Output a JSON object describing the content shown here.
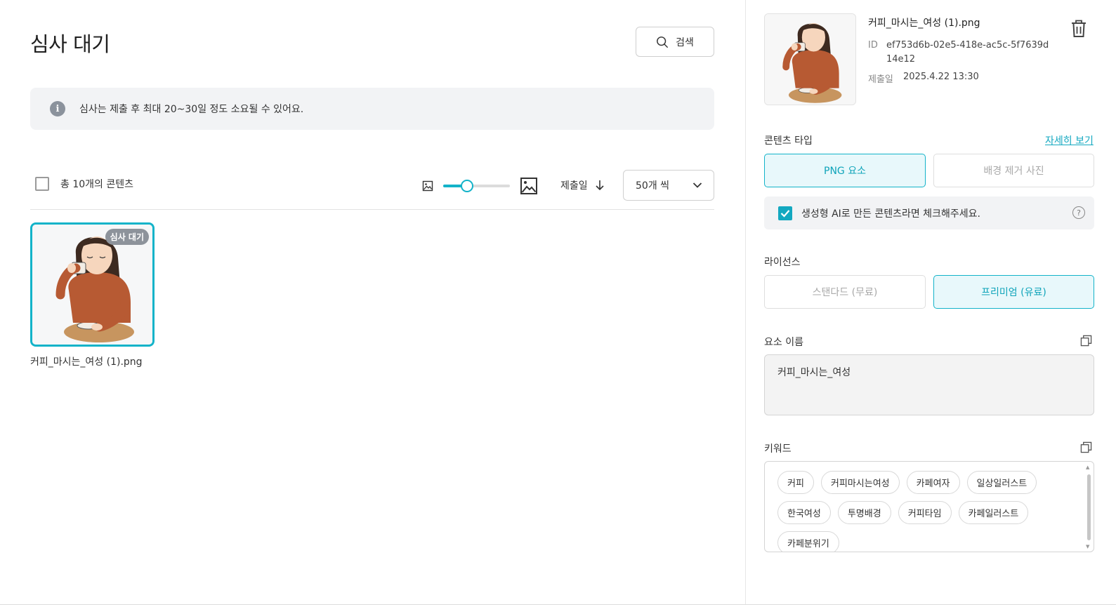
{
  "page": {
    "title": "심사 대기",
    "search_label": "검색",
    "notice": "심사는 제출 후 최대 20~30일 정도 소요될 수 있어요."
  },
  "toolbar": {
    "total_label": "총 10개의 콘텐츠",
    "thumb_size_level": 0.36,
    "sort_label": "제출일",
    "per_page_label": "50개 씩"
  },
  "items": [
    {
      "filename": "커피_마시는_여성 (1).png",
      "badge": "심사 대기"
    }
  ],
  "detail": {
    "filename": "커피_마시는_여성 (1).png",
    "id_label": "ID",
    "id_value": "ef753d6b-02e5-418e-ac5c-5f7639d14e12",
    "date_label": "제출일",
    "date_value": "2025.4.22 13:30",
    "content_type_label": "콘텐츠 타입",
    "detail_link": "자세히 보기",
    "content_types": [
      {
        "label": "PNG 요소",
        "active": true
      },
      {
        "label": "배경 제거 사진",
        "active": false
      }
    ],
    "ai_check_label": "생성형 AI로 만든 콘텐츠라면 체크해주세요.",
    "ai_checked": true,
    "license_label": "라이선스",
    "licenses": [
      {
        "label": "스탠다드 (무료)",
        "active": false
      },
      {
        "label": "프리미엄 (유료)",
        "active": true
      }
    ],
    "element_name_label": "요소 이름",
    "element_name_value": "커피_마시는_여성",
    "keywords_label": "키워드",
    "keywords": [
      "커피",
      "커피마시는여성",
      "카페여자",
      "일상일러스트",
      "한국여성",
      "투명배경",
      "커피타임",
      "카페일러스트",
      "카페분위기"
    ]
  },
  "colors": {
    "accent": "#13b3c9",
    "accent_bg": "#e8f8fb",
    "badge_gray": "#8d939b",
    "notice_bg": "#f2f3f5"
  }
}
